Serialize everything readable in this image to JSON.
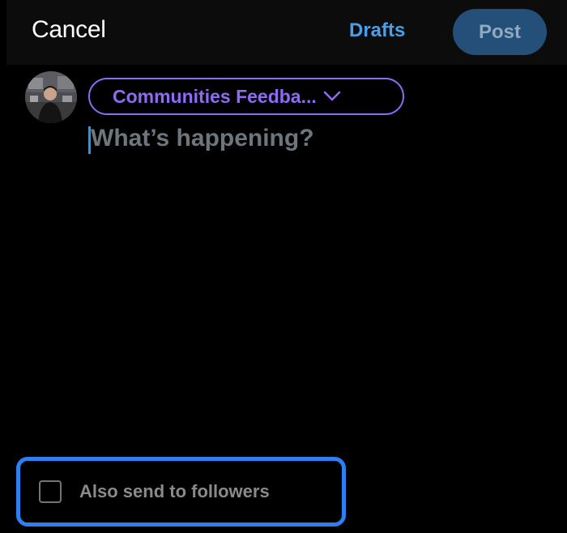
{
  "header": {
    "cancel_label": "Cancel",
    "drafts_label": "Drafts",
    "post_label": "Post"
  },
  "composer": {
    "audience_label": "Communities Feedba...",
    "placeholder": "What’s happening?"
  },
  "footer": {
    "also_send_label": "Also send to followers",
    "also_send_checked": false
  },
  "icons": {
    "avatar": "user-avatar-photo",
    "audience_chevron": "chevron-down-icon",
    "checkbox": "checkbox-unchecked-icon"
  },
  "colors": {
    "accent_blue": "#1d9bf0",
    "drafts_blue": "#4a9fe6",
    "post_button_disabled": "#234f78",
    "community_purple": "#8f6bf4",
    "highlight_box": "#2d7ff2"
  }
}
